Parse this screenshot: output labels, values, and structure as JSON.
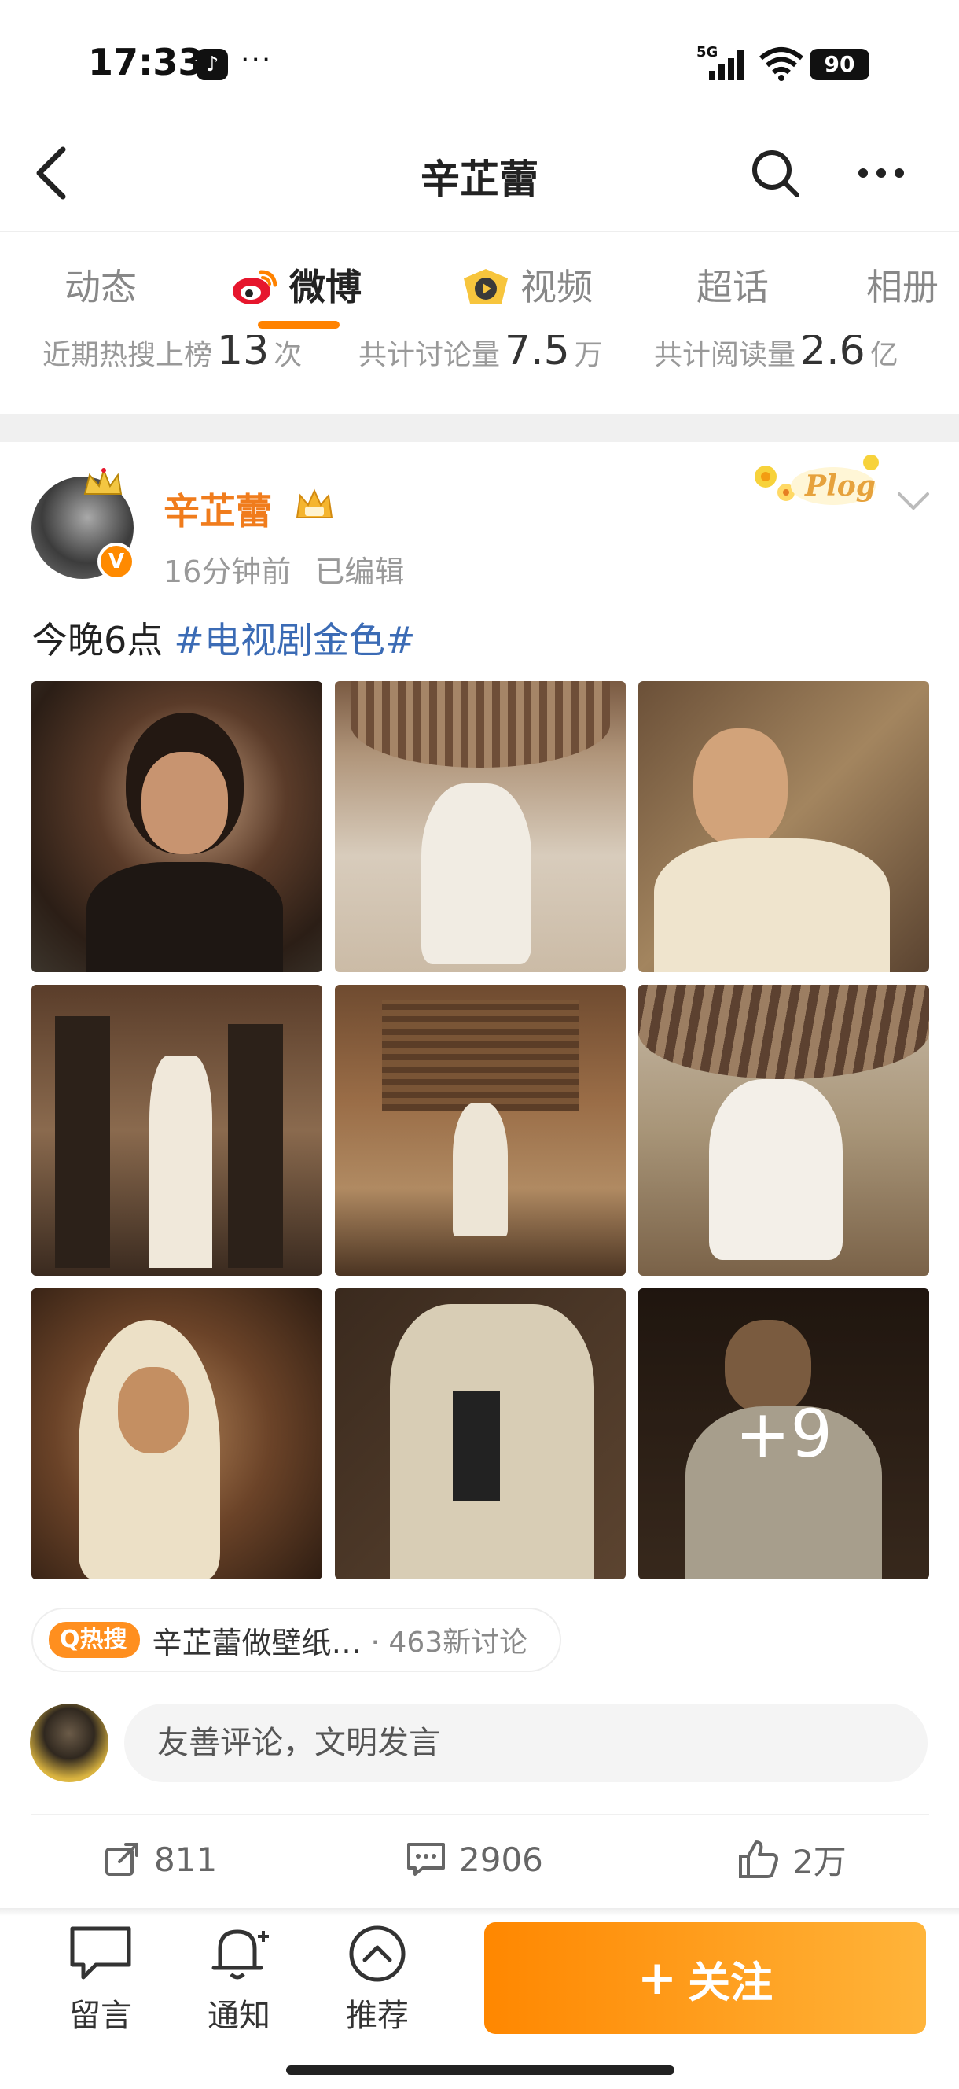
{
  "status_bar": {
    "time": "17:33",
    "app_icon": "tiktok-icon",
    "dots": "···",
    "network": "5G",
    "battery": "90"
  },
  "nav": {
    "title": "辛芷蕾",
    "back_icon": "back-arrow-icon",
    "search_icon": "search-icon",
    "more_icon": "more-icon"
  },
  "tabs": [
    {
      "label": "动态",
      "active": false
    },
    {
      "label": "微博",
      "active": true,
      "icon": "weibo-logo-icon"
    },
    {
      "label": "视频",
      "active": false,
      "icon": "video-play-icon"
    },
    {
      "label": "超话",
      "active": false
    },
    {
      "label": "相册",
      "active": false
    }
  ],
  "stats": [
    {
      "label": "近期热搜上榜",
      "value": "13",
      "unit": "次"
    },
    {
      "label": "共计讨论量",
      "value": "7.5",
      "unit": "万"
    },
    {
      "label": "共计阅读量",
      "value": "2.6",
      "unit": "亿"
    }
  ],
  "post": {
    "author": "辛芷蕾",
    "verified_badge": "V",
    "time": "16分钟前",
    "edited": "已编辑",
    "sticker": "Plog",
    "text": "今晚6点",
    "topic": "#电视剧金色#",
    "more_images": "+9",
    "images": [
      "photo-1",
      "photo-2",
      "photo-3",
      "photo-4",
      "photo-5",
      "photo-6",
      "photo-7",
      "photo-8",
      "photo-9"
    ]
  },
  "hot_search": {
    "badge": "热搜",
    "topic": "辛芷蕾做壁纸…",
    "count": "· 463新讨论"
  },
  "comment": {
    "placeholder": "友善评论，文明发言"
  },
  "actions": {
    "repost": "811",
    "comments": "2906",
    "likes": "2万"
  },
  "bottom_bar": {
    "message": "留言",
    "notify": "通知",
    "recommend": "推荐",
    "follow": "关注",
    "follow_plus": "+"
  },
  "colors": {
    "accent": "#ff8200",
    "username": "#f07c1c",
    "topic_link": "#3b6bb5",
    "follow_start": "#ff8700",
    "follow_end": "#ffb43a"
  }
}
